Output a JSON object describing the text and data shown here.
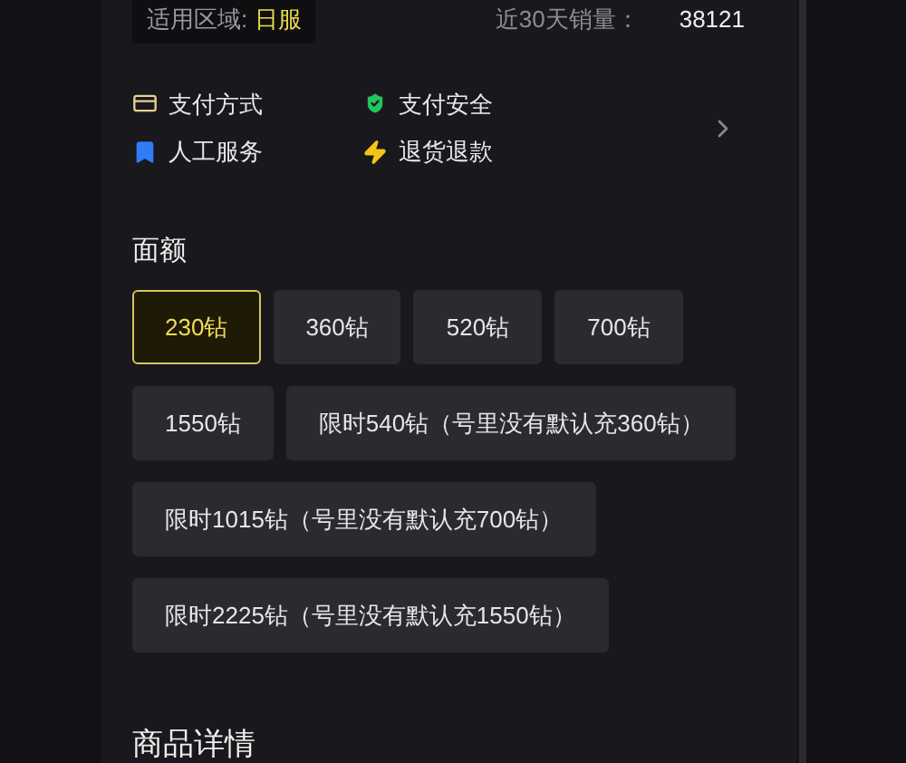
{
  "region": {
    "label": "适用区域:",
    "value": "日服"
  },
  "sales": {
    "label": "近30天销量：",
    "value": "38121"
  },
  "services": [
    {
      "kind": "card",
      "label": "支付方式"
    },
    {
      "kind": "shield",
      "label": "支付安全"
    },
    {
      "kind": "bookmark",
      "label": "人工服务"
    },
    {
      "kind": "bolt",
      "label": "退货退款"
    }
  ],
  "denomination": {
    "title": "面额",
    "options": [
      {
        "label": "230钻",
        "selected": true
      },
      {
        "label": "360钻",
        "selected": false
      },
      {
        "label": "520钻",
        "selected": false
      },
      {
        "label": "700钻",
        "selected": false
      },
      {
        "label": "1550钻",
        "selected": false
      },
      {
        "label": "限时540钻（号里没有默认充360钻）",
        "selected": false
      },
      {
        "label": "限时1015钻（号里没有默认充700钻）",
        "selected": false
      },
      {
        "label": "限时2225钻（号里没有默认充1550钻）",
        "selected": false
      }
    ]
  },
  "details": {
    "title": "商品详情"
  }
}
